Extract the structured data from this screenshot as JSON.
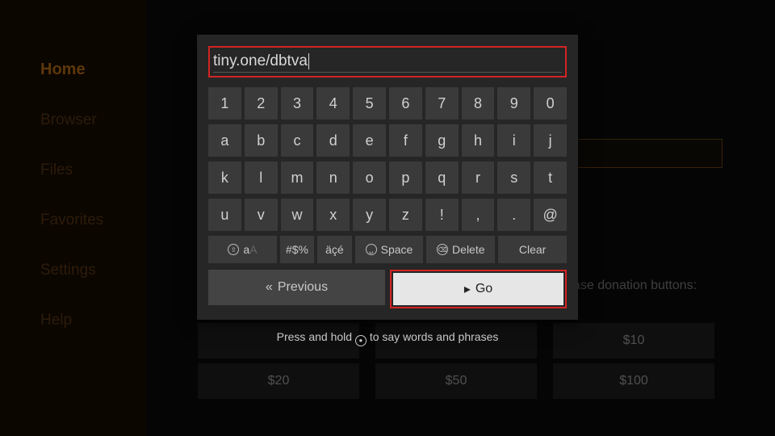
{
  "sidebar": {
    "items": [
      {
        "label": "Home",
        "active": true
      },
      {
        "label": "Browser",
        "active": false
      },
      {
        "label": "Files",
        "active": false
      },
      {
        "label": "Favorites",
        "active": false
      },
      {
        "label": "Settings",
        "active": false
      },
      {
        "label": "Help",
        "active": false
      }
    ]
  },
  "background": {
    "donation_text": "ase donation buttons:",
    "donation_row1": [
      "",
      "",
      "$10"
    ],
    "donation_row2": [
      "$20",
      "$50",
      "$100"
    ]
  },
  "keyboard": {
    "input_value": "tiny.one/dbtva",
    "row1": [
      "1",
      "2",
      "3",
      "4",
      "5",
      "6",
      "7",
      "8",
      "9",
      "0"
    ],
    "row2": [
      "a",
      "b",
      "c",
      "d",
      "e",
      "f",
      "g",
      "h",
      "i",
      "j"
    ],
    "row3": [
      "k",
      "l",
      "m",
      "n",
      "o",
      "p",
      "q",
      "r",
      "s",
      "t"
    ],
    "row4": [
      "u",
      "v",
      "w",
      "x",
      "y",
      "z",
      "!",
      ",",
      ".",
      "@"
    ],
    "fn": {
      "shift": "aA",
      "symbols": "#$%",
      "accents": "äçé",
      "space": "Space",
      "delete": "Delete",
      "clear": "Clear"
    },
    "previous": "Previous",
    "go": "Go",
    "hint_before": "Press and hold ",
    "hint_after": " to say words and phrases"
  }
}
